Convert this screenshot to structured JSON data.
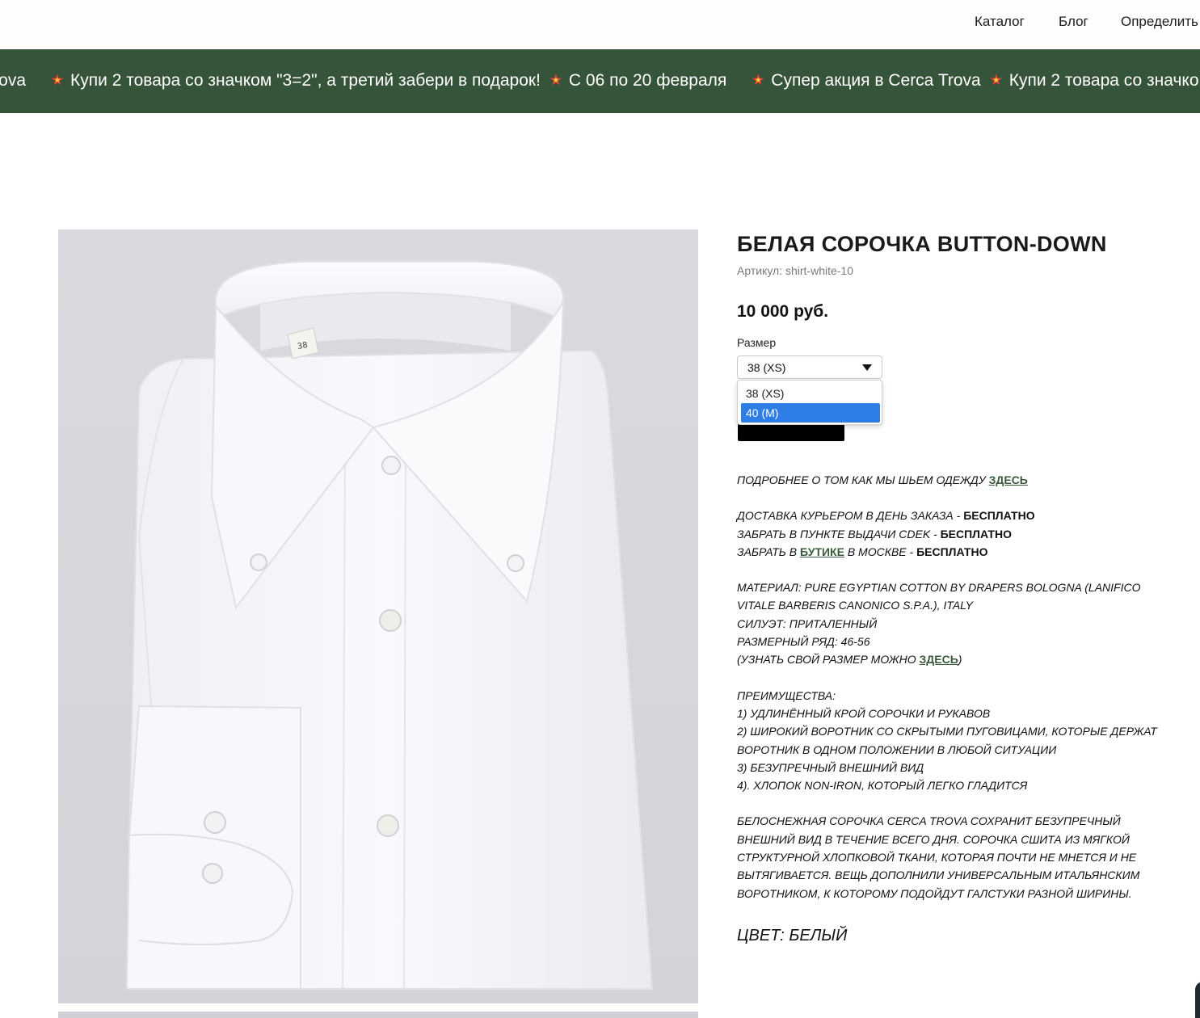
{
  "nav": {
    "items": [
      "Каталог",
      "Блог",
      "Определить"
    ]
  },
  "ticker": {
    "segments": [
      "n Trova",
      "Купи 2 товара со значком \"3=2\", а третий забери в подарок!",
      "С 06 по 20 февраля",
      "Супер акция в Cerca Trova",
      "Купи 2 товара со значко"
    ],
    "icon": "collision-burst-icon",
    "background": "#365439"
  },
  "product": {
    "title": "БЕЛАЯ СОРОЧКА BUTTON-DOWN",
    "sku": "Артикул: shirt-white-10",
    "price": "10 000 руб.",
    "size_label": "Размер",
    "size_selected": "38 (XS)",
    "size_options": [
      "38 (XS)",
      "40 (M)"
    ],
    "size_highlighted": "40 (M)",
    "collar_tag": "38"
  },
  "description": {
    "how_we_sew": "ПОДРОБНЕЕ О ТОМ КАК МЫ ШЬЕМ ОДЕЖДУ ",
    "how_we_sew_link": "ЗДЕСЬ",
    "delivery_courier": "ДОСТАВКА КУРЬЕРОМ В ДЕНЬ ЗАКАЗА - ",
    "free": "БЕСПЛАТНО",
    "pickup_cdek": "ЗАБРАТЬ В ПУНКТЕ ВЫДАЧИ CDEK - ",
    "pickup_boutique_pre": "ЗАБРАТЬ В ",
    "pickup_boutique_link": "БУТИКЕ",
    "pickup_boutique_post": " В МОСКВЕ - ",
    "material": "МАТЕРИАЛ: PURE EGYPTIAN COTTON BY DRAPERS BOLOGNA (LANIFICO VITALE BARBERIS CANONICO S.P.A.), ITALY",
    "silhouette": "СИЛУЭТ: ПРИТАЛЕННЫЙ",
    "size_range": "РАЗМЕРНЫЙ РЯД: 46-56",
    "find_size_pre": "(УЗНАТЬ СВОЙ РАЗМЕР МОЖНО ",
    "find_size_link": "ЗДЕСЬ",
    "find_size_post": ")",
    "advantages_title": "ПРЕИМУЩЕСТВА:",
    "advantages": [
      "1) УДЛИНЁННЫЙ КРОЙ СОРОЧКИ И РУКАВОВ",
      "2) ШИРОКИЙ ВОРОТНИК СО СКРЫТЫМИ ПУГОВИЦАМИ, КОТОРЫЕ ДЕРЖАТ ВОРОТНИК В ОДНОМ ПОЛОЖЕНИИ В ЛЮБОЙ СИТУАЦИИ",
      "3) БЕЗУПРЕЧНЫЙ ВНЕШНИЙ ВИД",
      "4). ХЛОПОК NON-IRON, КОТОРЫЙ ЛЕГКО ГЛАДИТСЯ"
    ],
    "paragraph": "БЕЛОСНЕЖНАЯ СОРОЧКА CERCA TROVA СОХРАНИТ БЕЗУПРЕЧНЫЙ ВНЕШНИЙ ВИД В ТЕЧЕНИЕ ВСЕГО ДНЯ. СОРОЧКА СШИТА ИЗ МЯГКОЙ СТРУКТУРНОЙ ХЛОПКОВОЙ ТКАНИ, КОТОРАЯ ПОЧТИ НЕ МНЕТСЯ И НЕ ВЫТЯГИВАЕТСЯ. ВЕЩЬ ДОПОЛНИЛИ УНИВЕРСАЛЬНЫМ ИТАЛЬЯНСКИМ ВОРОТНИКОМ, К КОТОРОМУ ПОДОЙДУТ ГАЛСТУКИ РАЗНОЙ ШИРИНЫ.",
    "color": "ЦВЕТ: БЕЛЫЙ"
  },
  "colors": {
    "accent_green": "#365439",
    "link_green": "#3a5a3c",
    "select_highlight": "#2f7ee6"
  }
}
